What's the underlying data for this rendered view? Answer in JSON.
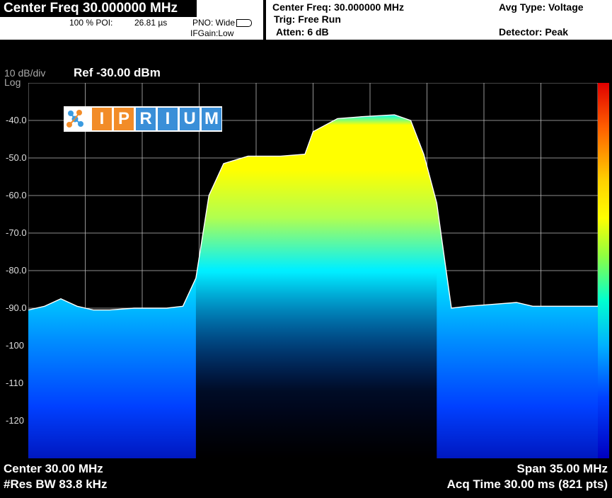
{
  "header": {
    "title": "Center Freq 30.000000 MHz",
    "poi_label": "100 % POI:",
    "poi_value": "26.81 µs",
    "pno": "PNO: Wide",
    "ifgain": "IFGain:Low",
    "center_freq": "Center Freq: 30.000000 MHz",
    "trig": "Trig: Free Run",
    "atten": "Atten: 6 dB",
    "avg_type": "Avg Type: Voltage",
    "detector": "Detector: Peak"
  },
  "scale": {
    "div": "10 dB/div",
    "mode": "Log",
    "ref": "Ref -30.00 dBm"
  },
  "logo_letters": [
    "I",
    "P",
    "R",
    "I",
    "U",
    "M"
  ],
  "footer": {
    "center": "Center 30.00 MHz",
    "res_bw": "#Res BW 83.8 kHz",
    "span": "Span 35.00 MHz",
    "acq_time": "Acq Time  30.00 ms (821 pts)"
  },
  "colors": {
    "background": "#000000",
    "trace_peak": "#ffffff",
    "density_high": "#ffff00",
    "density_mid": "#00ffff",
    "density_low": "#0020ff"
  },
  "chart_data": {
    "type": "area",
    "title": "",
    "xlabel": "",
    "ylabel": "",
    "ylim": [
      -130,
      -30
    ],
    "x_unit": "MHz",
    "xlim": [
      12.5,
      47.5
    ],
    "yticks": [
      "-40.0",
      "-50.0",
      "-60.0",
      "-70.0",
      "-80.0",
      "-90.0",
      "-100",
      "-110",
      "-120"
    ],
    "ytick_values": [
      -40,
      -50,
      -60,
      -70,
      -80,
      -90,
      -100,
      -110,
      -120
    ],
    "x_gridlines": 10,
    "grid": true,
    "colorbar": "right",
    "series": [
      {
        "x": [
          12.5,
          13.5,
          14.5,
          15.5,
          16.5,
          17.5,
          19.0,
          21.0,
          22.0,
          22.8,
          23.6,
          24.5,
          26.0,
          28.0,
          29.5,
          30.0,
          31.5,
          33.0,
          35.0,
          36.0,
          36.8,
          37.6,
          38.5,
          39.5,
          41.0,
          42.5,
          43.5,
          45.0,
          47.5
        ],
        "values": [
          -90.5,
          -89.5,
          -87.5,
          -89.5,
          -90.5,
          -90.5,
          -90.0,
          -90.0,
          -89.5,
          -82.0,
          -60.0,
          -51.5,
          -49.5,
          -49.5,
          -49.0,
          -43.0,
          -39.5,
          -39.0,
          -38.5,
          -40.0,
          -49.0,
          -62.0,
          -90.0,
          -89.5,
          -89.0,
          -88.5,
          -89.5,
          -89.5,
          -89.5
        ]
      }
    ]
  }
}
